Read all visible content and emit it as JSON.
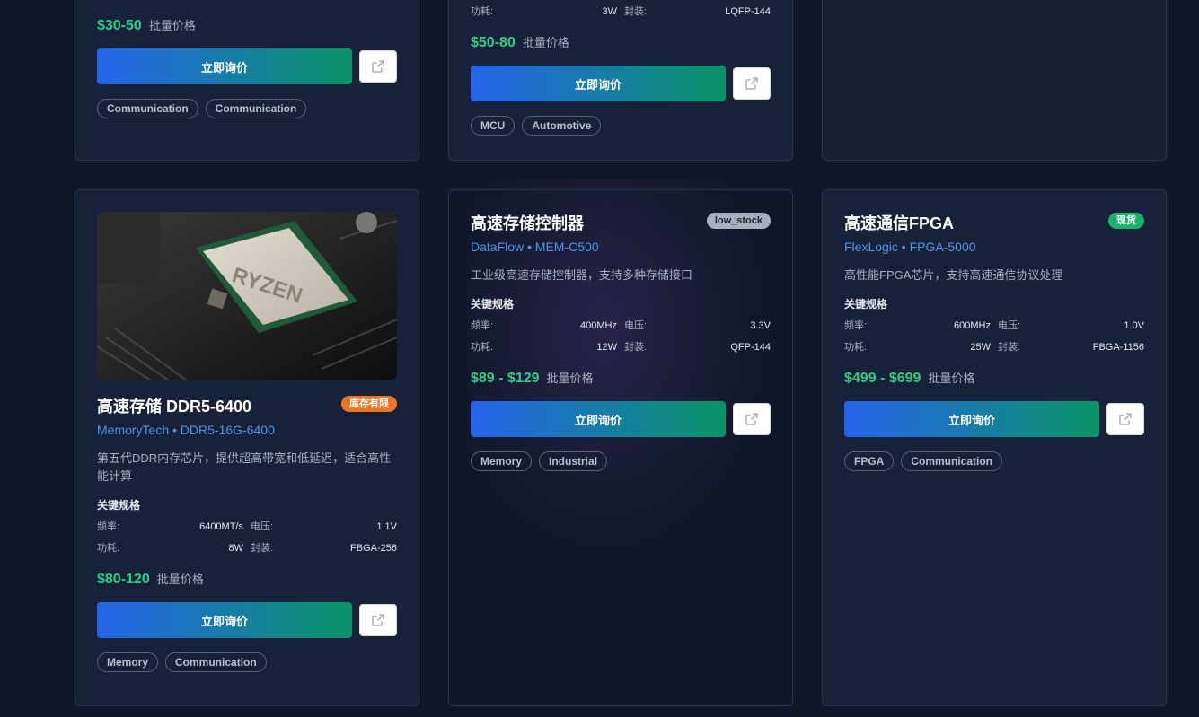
{
  "common": {
    "inquire_label": "立即询价",
    "price_note": "批量价格",
    "specs_heading": "关键规格"
  },
  "top_cards": [
    {
      "price": "$30-50",
      "tags": [
        "Communication",
        "Communication"
      ]
    },
    {
      "specs": [
        {
          "k": "功耗:",
          "v": "3W"
        },
        {
          "k": "封装:",
          "v": "LQFP-144"
        }
      ],
      "price": "$50-80",
      "tags": [
        "MCU",
        "Automotive"
      ]
    },
    {}
  ],
  "cards": [
    {
      "image_alt": "RYZEN",
      "title": "高速存储 DDR5-6400",
      "badge": "库存有限",
      "badge_color": "#f07424",
      "subtitle": "MemoryTech • DDR5-16G-6400",
      "desc": "第五代DDR内存芯片，提供超高带宽和低延迟，适合高性能计算",
      "specs": [
        {
          "k": "频率:",
          "v": "6400MT/s"
        },
        {
          "k": "电压:",
          "v": "1.1V"
        },
        {
          "k": "功耗:",
          "v": "8W"
        },
        {
          "k": "封装:",
          "v": "FBGA-256"
        }
      ],
      "price": "$80-120",
      "tags": [
        "Memory",
        "Communication"
      ]
    },
    {
      "title": "高速存储控制器",
      "badge": "low_stock",
      "badge_color": "#a9b0bd",
      "subtitle": "DataFlow • MEM-C500",
      "desc": "工业级高速存储控制器，支持多种存储接口",
      "specs": [
        {
          "k": "频率:",
          "v": "400MHz"
        },
        {
          "k": "电压:",
          "v": "3.3V"
        },
        {
          "k": "功耗:",
          "v": "12W"
        },
        {
          "k": "封装:",
          "v": "QFP-144"
        }
      ],
      "price": "$89 - $129",
      "tags": [
        "Memory",
        "Industrial"
      ]
    },
    {
      "title": "高速通信FPGA",
      "badge": "现货",
      "badge_color": "#17b36a",
      "subtitle": "FlexLogic • FPGA-5000",
      "desc": "高性能FPGA芯片，支持高速通信协议处理",
      "specs": [
        {
          "k": "频率:",
          "v": "600MHz"
        },
        {
          "k": "电压:",
          "v": "1.0V"
        },
        {
          "k": "功耗:",
          "v": "25W"
        },
        {
          "k": "封装:",
          "v": "FBGA-1156"
        }
      ],
      "price": "$499 - $699",
      "tags": [
        "FPGA",
        "Communication"
      ]
    }
  ]
}
